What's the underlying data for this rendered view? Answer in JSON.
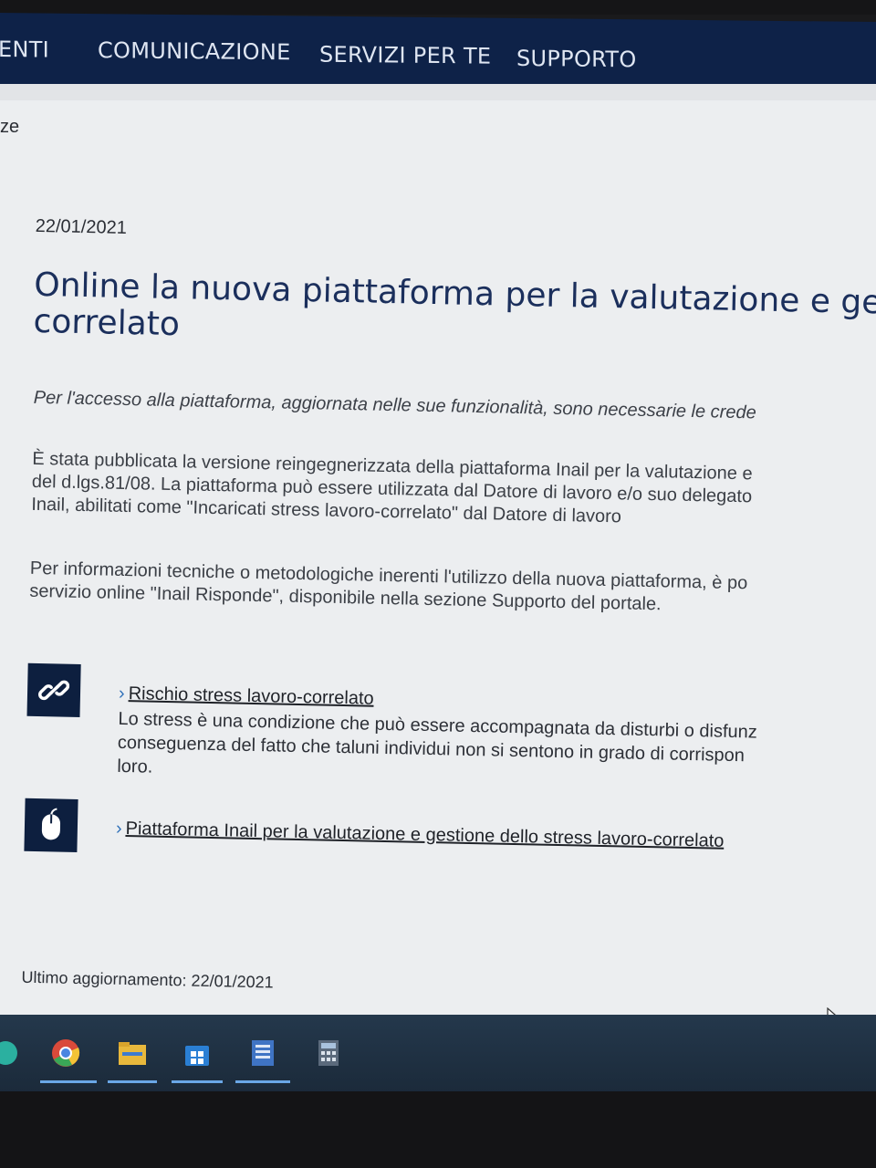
{
  "nav": {
    "items": [
      "ENTI",
      "COMUNICAZIONE",
      "SERVIZI PER TE",
      "SUPPORTO"
    ]
  },
  "breadcrumb_fragment": "ze",
  "article": {
    "date": "22/01/2021",
    "title_lines": [
      "Online la nuova piattaforma per la valutazione e gest",
      "correlato"
    ],
    "intro": "Per l'accesso alla piattaforma, aggiornata nelle sue funzionalità, sono necessarie le crede",
    "paragraph1": [
      "È stata pubblicata la versione reingegnerizzata della piattaforma Inail per la valutazione e",
      "del d.lgs.81/08. La piattaforma può essere utilizzata dal Datore di lavoro e/o suo delegato",
      "Inail, abilitati come \"Incaricati stress lavoro-correlato\" dal Datore di lavoro"
    ],
    "paragraph2": [
      "Per informazioni tecniche o metodologiche inerenti l'utilizzo della nuova piattaforma, è po",
      "servizio online \"Inail Risponde\", disponibile nella sezione Supporto del portale."
    ]
  },
  "links": [
    {
      "label": "Rischio stress lavoro-correlato",
      "icon": "link-icon",
      "description": [
        "Lo stress è una condizione che può essere accompagnata da disturbi o disfunz",
        "conseguenza del fatto che taluni individui non si sentono in grado di corrispon",
        "loro."
      ]
    },
    {
      "label": "Piattaforma Inail per la valutazione e gestione dello stress lavoro-correlato",
      "icon": "mouse-icon"
    }
  ],
  "last_update": "Ultimo aggiornamento: 22/01/2021",
  "taskbar": {
    "apps": [
      "chrome-icon",
      "file-explorer-icon",
      "microsoft-store-icon",
      "word-document-icon",
      "calculator-icon"
    ]
  },
  "colors": {
    "navbar": "#0e2248",
    "title": "#1b2f5c",
    "icon_box": "#0d1f3f",
    "link_chevron": "#2d6fb8"
  }
}
